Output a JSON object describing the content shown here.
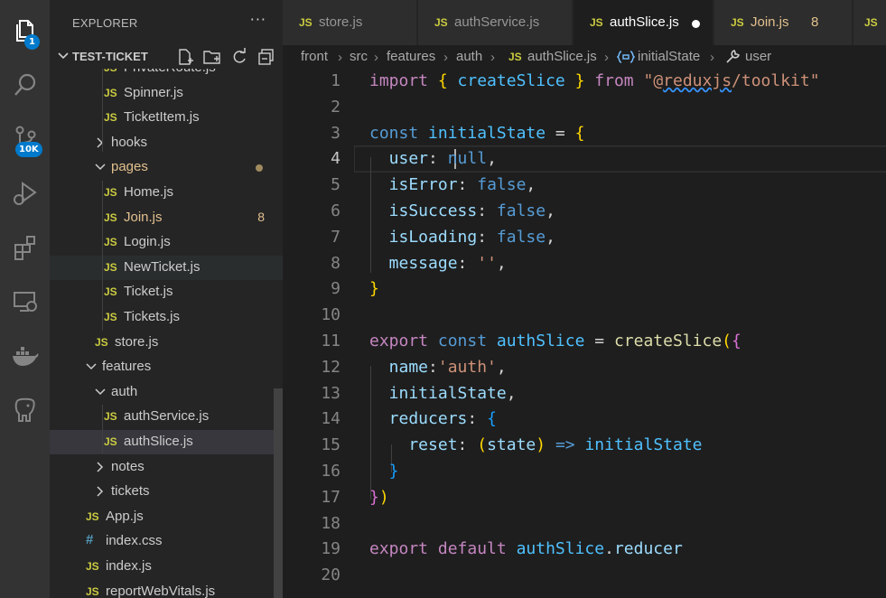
{
  "activity_bar": {
    "items": [
      {
        "name": "explorer",
        "icon": "files-icon",
        "badge": "1"
      },
      {
        "name": "search",
        "icon": "search-icon"
      },
      {
        "name": "source-control",
        "icon": "source-control-icon",
        "badge": "10K"
      },
      {
        "name": "run-debug",
        "icon": "run-debug-icon"
      },
      {
        "name": "extensions",
        "icon": "extensions-icon"
      },
      {
        "name": "remote-explorer",
        "icon": "remote-explorer-icon"
      },
      {
        "name": "docker",
        "icon": "docker-icon"
      },
      {
        "name": "postgres",
        "icon": "database-elephant-icon"
      }
    ]
  },
  "sidebar": {
    "title": "EXPLORER",
    "more": "···",
    "project": "TEST-TICKET",
    "tree": [
      {
        "label": "PrivateRoute.js",
        "type": "js",
        "depth": 3
      },
      {
        "label": "Spinner.js",
        "type": "js",
        "depth": 3
      },
      {
        "label": "TicketItem.js",
        "type": "js",
        "depth": 3
      },
      {
        "label": "hooks",
        "type": "folder",
        "depth": 2,
        "open": false
      },
      {
        "label": "pages",
        "type": "folder",
        "depth": 2,
        "open": true,
        "modified": true,
        "dot": true
      },
      {
        "label": "Home.js",
        "type": "js",
        "depth": 3
      },
      {
        "label": "Join.js",
        "type": "js",
        "depth": 3,
        "modified": true,
        "badge": "8"
      },
      {
        "label": "Login.js",
        "type": "js",
        "depth": 3
      },
      {
        "label": "NewTicket.js",
        "type": "js",
        "depth": 3,
        "hover": true
      },
      {
        "label": "Ticket.js",
        "type": "js",
        "depth": 3
      },
      {
        "label": "Tickets.js",
        "type": "js",
        "depth": 3
      },
      {
        "label": "store.js",
        "type": "js",
        "depth": 2
      },
      {
        "label": "features",
        "type": "folder",
        "depth": 1,
        "open": true
      },
      {
        "label": "auth",
        "type": "folder",
        "depth": 2,
        "open": true
      },
      {
        "label": "authService.js",
        "type": "js",
        "depth": 3
      },
      {
        "label": "authSlice.js",
        "type": "js",
        "depth": 3,
        "selected": true
      },
      {
        "label": "notes",
        "type": "folder",
        "depth": 2,
        "open": false
      },
      {
        "label": "tickets",
        "type": "folder",
        "depth": 2,
        "open": false
      },
      {
        "label": "App.js",
        "type": "js",
        "depth": 1
      },
      {
        "label": "index.css",
        "type": "css",
        "depth": 1
      },
      {
        "label": "index.js",
        "type": "js",
        "depth": 1
      },
      {
        "label": "reportWebVitals.js",
        "type": "js",
        "depth": 1
      }
    ]
  },
  "tabs": [
    {
      "label": "store.js",
      "icon": "JS"
    },
    {
      "label": "authService.js",
      "icon": "JS"
    },
    {
      "label": "authSlice.js",
      "icon": "JS",
      "active": true,
      "dirty": true
    },
    {
      "label": "Join.js",
      "icon": "JS",
      "modified": true,
      "badge": "8"
    },
    {
      "label": "",
      "icon": "JS"
    }
  ],
  "breadcrumb": {
    "parts": [
      "front",
      "src",
      "features",
      "auth"
    ],
    "file_icon": "JS",
    "file": "authSlice.js",
    "symbol1_icon": "variable-braces-icon",
    "symbol1": "initialState",
    "symbol2_icon": "wrench-icon",
    "symbol2": "user"
  },
  "editor": {
    "active_line": 4,
    "lines": [
      {
        "n": "1",
        "tokens": [
          {
            "t": "import ",
            "c": "kw"
          },
          {
            "t": "{ ",
            "c": "br1"
          },
          {
            "t": "createSlice",
            "c": "var"
          },
          {
            "t": " }",
            "c": "br1"
          },
          {
            "t": " from ",
            "c": "kw"
          },
          {
            "t": "\"@",
            "c": "str"
          },
          {
            "t": "reduxjs",
            "c": "str squig"
          },
          {
            "t": "/toolkit\"",
            "c": "str"
          }
        ]
      },
      {
        "n": "2",
        "tokens": []
      },
      {
        "n": "3",
        "tokens": [
          {
            "t": "const ",
            "c": "st"
          },
          {
            "t": "initialState",
            "c": "var"
          },
          {
            "t": " = ",
            "c": ""
          },
          {
            "t": "{",
            "c": "br1"
          }
        ]
      },
      {
        "n": "4",
        "tokens": [
          {
            "t": "  user",
            "c": "prop"
          },
          {
            "t": ": ",
            "c": ""
          },
          {
            "t": "null",
            "c": "st"
          },
          {
            "t": ",",
            "c": ""
          }
        ]
      },
      {
        "n": "5",
        "tokens": [
          {
            "t": "  isError",
            "c": "prop"
          },
          {
            "t": ": ",
            "c": ""
          },
          {
            "t": "false",
            "c": "st"
          },
          {
            "t": ",",
            "c": ""
          }
        ]
      },
      {
        "n": "6",
        "tokens": [
          {
            "t": "  isSuccess",
            "c": "prop"
          },
          {
            "t": ": ",
            "c": ""
          },
          {
            "t": "false",
            "c": "st"
          },
          {
            "t": ",",
            "c": ""
          }
        ]
      },
      {
        "n": "7",
        "tokens": [
          {
            "t": "  isLoading",
            "c": "prop"
          },
          {
            "t": ": ",
            "c": ""
          },
          {
            "t": "false",
            "c": "st"
          },
          {
            "t": ",",
            "c": ""
          }
        ]
      },
      {
        "n": "8",
        "tokens": [
          {
            "t": "  message",
            "c": "prop"
          },
          {
            "t": ": ",
            "c": ""
          },
          {
            "t": "''",
            "c": "str"
          },
          {
            "t": ",",
            "c": ""
          }
        ]
      },
      {
        "n": "9",
        "tokens": [
          {
            "t": "}",
            "c": "br1"
          }
        ]
      },
      {
        "n": "10",
        "tokens": []
      },
      {
        "n": "11",
        "tokens": [
          {
            "t": "export ",
            "c": "kw"
          },
          {
            "t": "const ",
            "c": "st"
          },
          {
            "t": "authSlice",
            "c": "var"
          },
          {
            "t": " = ",
            "c": ""
          },
          {
            "t": "createSlice",
            "c": "fn"
          },
          {
            "t": "(",
            "c": "br1"
          },
          {
            "t": "{",
            "c": "br2"
          }
        ]
      },
      {
        "n": "12",
        "tokens": [
          {
            "t": "  name",
            "c": "prop"
          },
          {
            "t": ":",
            "c": ""
          },
          {
            "t": "'auth'",
            "c": "str"
          },
          {
            "t": ",",
            "c": ""
          }
        ]
      },
      {
        "n": "13",
        "tokens": [
          {
            "t": "  initialState",
            "c": "prop"
          },
          {
            "t": ",",
            "c": ""
          }
        ]
      },
      {
        "n": "14",
        "tokens": [
          {
            "t": "  reducers",
            "c": "prop"
          },
          {
            "t": ": ",
            "c": ""
          },
          {
            "t": "{",
            "c": "br3"
          }
        ]
      },
      {
        "n": "15",
        "tokens": [
          {
            "t": "    reset",
            "c": "prop"
          },
          {
            "t": ": ",
            "c": ""
          },
          {
            "t": "(",
            "c": "br1"
          },
          {
            "t": "state",
            "c": "prop"
          },
          {
            "t": ")",
            "c": "br1"
          },
          {
            "t": " => ",
            "c": "st"
          },
          {
            "t": "initialState",
            "c": "var"
          }
        ]
      },
      {
        "n": "16",
        "tokens": [
          {
            "t": "  }",
            "c": "br3"
          }
        ]
      },
      {
        "n": "17",
        "tokens": [
          {
            "t": "}",
            "c": "br2"
          },
          {
            "t": ")",
            "c": "br1"
          }
        ]
      },
      {
        "n": "18",
        "tokens": []
      },
      {
        "n": "19",
        "tokens": [
          {
            "t": "export ",
            "c": "kw"
          },
          {
            "t": "default ",
            "c": "kw"
          },
          {
            "t": "authSlice",
            "c": "var"
          },
          {
            "t": ".",
            "c": ""
          },
          {
            "t": "reducer",
            "c": "prop"
          }
        ]
      },
      {
        "n": "20",
        "tokens": []
      }
    ]
  }
}
